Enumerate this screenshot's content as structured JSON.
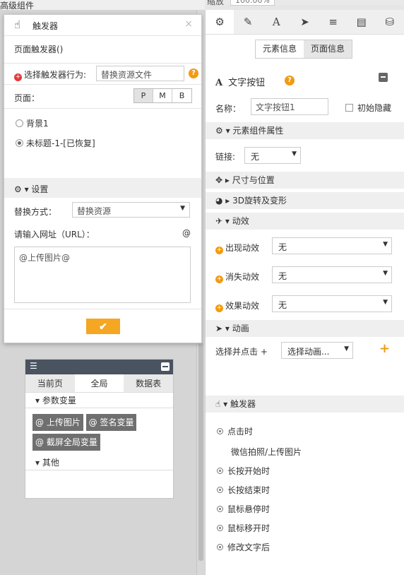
{
  "topbar": {
    "crumb": "高级组件",
    "zoom_label": "缩放",
    "zoom_value": "100.00%"
  },
  "trigger_dialog": {
    "title": "触发器",
    "subtitle": "页面触发器()",
    "select_label": "选择触发器行为:",
    "select_value": "替换资源文件",
    "page_label": "页面：",
    "device_buttons": [
      "P",
      "M",
      "B"
    ],
    "device_selected": "P",
    "pages": [
      {
        "label": "背景1",
        "selected": false
      },
      {
        "label": "未标题-1-[已恢复]",
        "selected": true
      }
    ],
    "settings_title": "设置",
    "replace_mode_label": "替换方式：",
    "replace_mode_value": "替换资源",
    "url_label": "请输入网址（URL）：",
    "at_symbol": "@",
    "url_value": "@上传图片@",
    "confirm_icon": "✔"
  },
  "variables_panel": {
    "tabs": [
      "当前页",
      "全局",
      "数据表"
    ],
    "active_tab": "全局",
    "param_section": "参数变量",
    "tags": [
      "@ 上传图片",
      "@ 签名变量",
      "@ 截屏全局变量"
    ],
    "other_section": "其他"
  },
  "right_panel": {
    "tab_icons": [
      "gear-icon",
      "pencil-icon",
      "text-icon",
      "send-icon",
      "list-icon",
      "document-icon",
      "database-icon"
    ],
    "segments": [
      "元素信息",
      "页面信息"
    ],
    "active_segment": "页面信息",
    "element_type": "文字按钮",
    "name_label": "名称：",
    "name_value": "文字按钮1",
    "initial_hidden_label": "初始隐藏",
    "component_props_title": "元素组件属性",
    "link_label": "链接:",
    "link_value": "无",
    "size_position_title": "尺寸与位置",
    "rotate_title": "3D旋转及变形",
    "effects_title": "动效",
    "effects": [
      {
        "label": "出现动效",
        "value": "无"
      },
      {
        "label": "消失动效",
        "value": "无"
      },
      {
        "label": "效果动效",
        "value": "无"
      }
    ],
    "animation_title": "动画",
    "anim_select_label": "选择并点击 +",
    "anim_select_value": "选择动画...",
    "trigger_title": "触发器",
    "triggers": [
      {
        "label": "点击时",
        "marker": true
      },
      {
        "label": "微信拍照/上传图片",
        "marker": false
      },
      {
        "label": "长按开始时",
        "marker": true
      },
      {
        "label": "长按结束时",
        "marker": true
      },
      {
        "label": "鼠标悬停时",
        "marker": true
      },
      {
        "label": "鼠标移开时",
        "marker": true
      },
      {
        "label": "修改文字后",
        "marker": true
      }
    ]
  }
}
